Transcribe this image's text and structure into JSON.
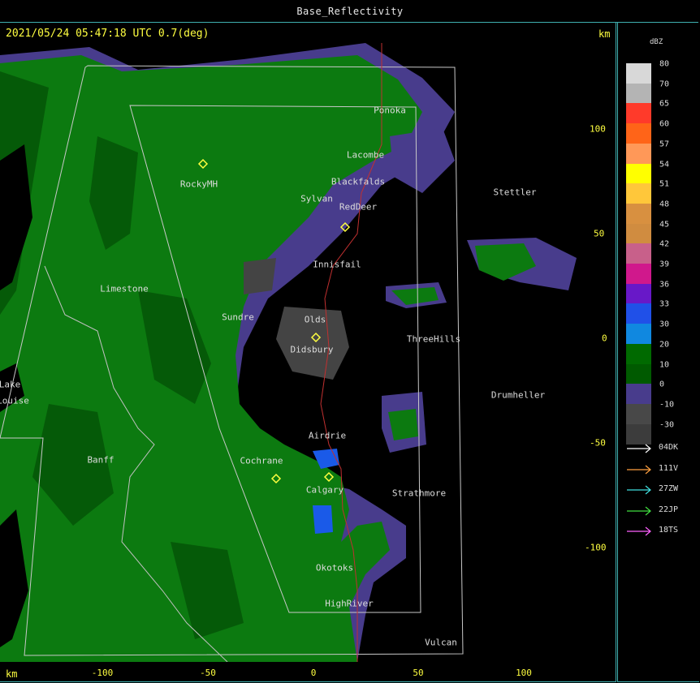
{
  "product": {
    "title": "Base_Reflectivity"
  },
  "header": {
    "timestamp": "2021/05/24 05:47:18 UTC 0.7(deg)",
    "km_unit": "km"
  },
  "axes": {
    "unit": "km",
    "x_ticks": [
      "-100",
      "-50",
      "0",
      "50",
      "100"
    ],
    "y_ticks": [
      "100",
      "50",
      "0",
      "-50",
      "-100"
    ]
  },
  "places": [
    "Ponoka",
    "Lacombe",
    "Blackfalds",
    "RockyMH",
    "Sylvan",
    "RedDeer",
    "Stettler",
    "Innisfail",
    "Limestone",
    "Sundre",
    "Olds",
    "Didsbury",
    "ThreeHills",
    "Lake",
    "Louise",
    "Drumheller",
    "Airdrie",
    "Banff",
    "Cochrane",
    "Calgary",
    "Strathmore",
    "Okotoks",
    "HighRiver",
    "Vulcan"
  ],
  "legend": {
    "unit": "dBZ",
    "levels": [
      {
        "label": "80",
        "color": "#d8d8d8"
      },
      {
        "label": "70",
        "color": "#b4b4b4"
      },
      {
        "label": "65",
        "color": "#ff3a2a"
      },
      {
        "label": "60",
        "color": "#ff6418"
      },
      {
        "label": "57",
        "color": "#ff9858"
      },
      {
        "label": "54",
        "color": "#ffff00"
      },
      {
        "label": "51",
        "color": "#ffc73a"
      },
      {
        "label": "48",
        "color": "#d89040"
      },
      {
        "label": "45",
        "color": "#d08c40"
      },
      {
        "label": "42",
        "color": "#c8608a"
      },
      {
        "label": "39",
        "color": "#d0188c"
      },
      {
        "label": "36",
        "color": "#6818c8"
      },
      {
        "label": "33",
        "color": "#2050e8"
      },
      {
        "label": "30",
        "color": "#1088e0"
      },
      {
        "label": "20",
        "color": "#006a00"
      },
      {
        "label": "10",
        "color": "#005a00"
      },
      {
        "label": "0",
        "color": "#483c8c"
      },
      {
        "label": "-10",
        "color": "#484848"
      },
      {
        "label": "-30",
        "color": "#3c3c3c"
      }
    ],
    "radars": [
      {
        "name": "04DK",
        "color": "#ffffff"
      },
      {
        "name": "111V",
        "color": "#ffa040"
      },
      {
        "name": "27ZW",
        "color": "#40e0e0"
      },
      {
        "name": "22JP",
        "color": "#40e040"
      },
      {
        "name": "18TS",
        "color": "#ff60ff"
      }
    ]
  },
  "colors": {
    "frame": "#3fb0b0",
    "annotation": "#ffff40",
    "echo_light": "#0c7a10",
    "echo_dark": "#055a08",
    "echo_weak": "#483c8c",
    "echo_noise": "#444444",
    "echo_heavy": "#1a5ae8"
  }
}
